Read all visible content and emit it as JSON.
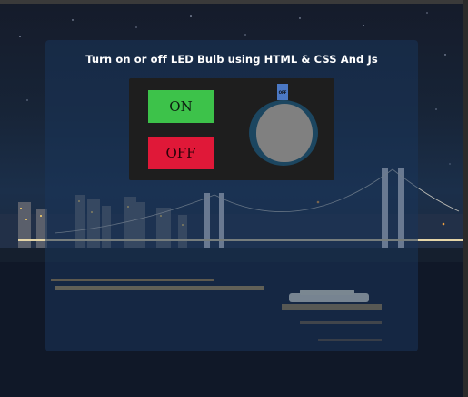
{
  "page": {
    "title": "Turn on or off LED Bulb using HTML & CSS And Js"
  },
  "controls": {
    "on_label": "ON",
    "off_label": "OFF"
  },
  "bulb": {
    "state_label": "OFF"
  },
  "colors": {
    "on_button": "#3dc24a",
    "off_button": "#e01838",
    "bulb_glass": "#808080",
    "bulb_cap": "#4b78c4",
    "panel_bg": "#19345a",
    "control_box": "#1e1e1e"
  }
}
